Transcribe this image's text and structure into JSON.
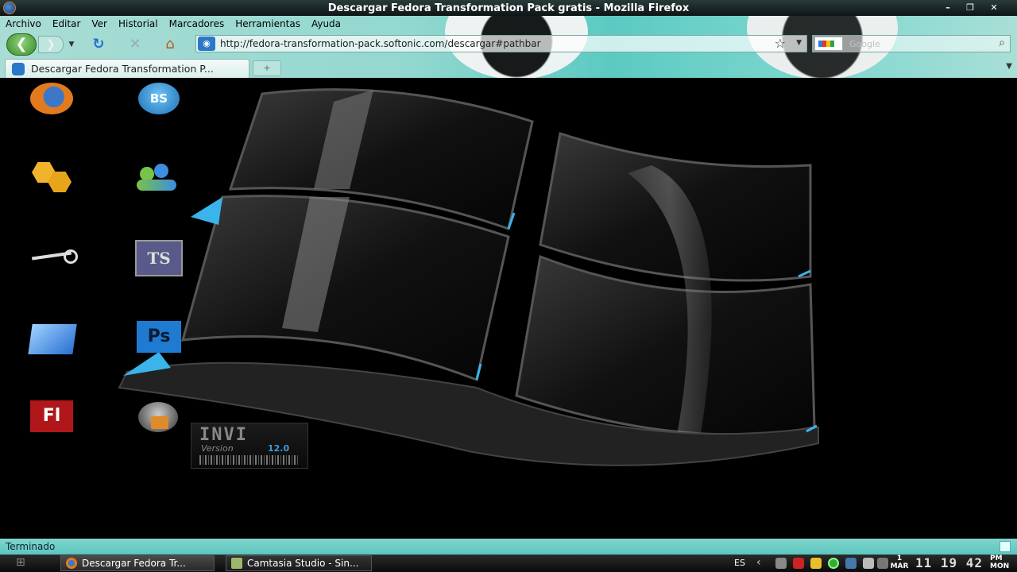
{
  "window": {
    "title": "Descargar Fedora Transformation Pack gratis - Mozilla Firefox",
    "min": "–",
    "max": "❐",
    "close": "✕"
  },
  "menu": [
    "Archivo",
    "Editar",
    "Ver",
    "Historial",
    "Marcadores",
    "Herramientas",
    "Ayuda"
  ],
  "nav": {
    "url": "http://fedora-transformation-pack.softonic.com/descargar#pathbar",
    "search_placeholder": "Google",
    "back": "❮",
    "forward": "❯"
  },
  "tabs": [
    {
      "label": "Descargar Fedora Transformation P..."
    }
  ],
  "desktop_icons": [
    "firefox-icon",
    "bs-player-icon",
    "tools-icon",
    "messenger-icon",
    "steam-icon",
    "ts-icon",
    "folder-icon",
    "photoshop-icon",
    "flash-icon",
    "security-icon"
  ],
  "icon_text": {
    "bs": "BS",
    "ts": "TS",
    "ps": "Ps",
    "fl": "Fl"
  },
  "wallpaper": {
    "badge_main": "INVI",
    "badge_version_label": "Version",
    "badge_version": "12.0"
  },
  "status": {
    "text": "Terminado"
  },
  "taskbar": {
    "tasks": [
      {
        "label": "Descargar Fedora Tr..."
      },
      {
        "label": "Camtasia Studio - Sin..."
      }
    ],
    "tray": {
      "lang": "ES",
      "day": "1",
      "month": "MAR",
      "time": "11 19 42",
      "ampm": "PM",
      "weekday": "MON"
    }
  },
  "colors": {
    "persona": "#5ccac2",
    "accent": "#3b9be0"
  }
}
